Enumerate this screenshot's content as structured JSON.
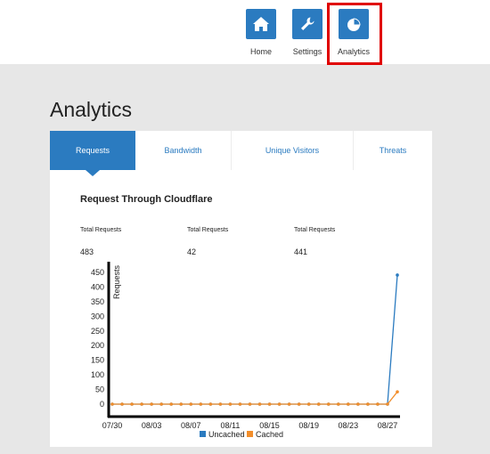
{
  "nav": {
    "items": [
      {
        "label": "Home",
        "icon": "home-icon"
      },
      {
        "label": "Settings",
        "icon": "wrench-icon"
      },
      {
        "label": "Analytics",
        "icon": "pie-chart-icon"
      }
    ],
    "highlighted": "Analytics",
    "icon_color": "#2b7bc0",
    "highlight_color": "#e00000"
  },
  "page": {
    "title": "Analytics"
  },
  "tabs": [
    {
      "label": "Requests",
      "active": true
    },
    {
      "label": "Bandwidth",
      "active": false
    },
    {
      "label": "Unique Visitors",
      "active": false
    },
    {
      "label": "Threats",
      "active": false
    }
  ],
  "section": {
    "title": "Request Through Cloudflare"
  },
  "stats": [
    {
      "label": "Total Requests",
      "value": "483"
    },
    {
      "label": "Total Requests",
      "value": "42"
    },
    {
      "label": "Total Requests",
      "value": "441"
    }
  ],
  "chart_data": {
    "type": "line",
    "ylabel": "Requests",
    "ylim": [
      0,
      450
    ],
    "yticks": [
      0,
      50,
      100,
      150,
      200,
      250,
      300,
      350,
      400,
      450
    ],
    "xtick_labels": [
      "07/30",
      "08/03",
      "08/07",
      "08/11",
      "08/15",
      "08/19",
      "08/23",
      "08/27"
    ],
    "x": [
      "07/30",
      "07/31",
      "08/01",
      "08/02",
      "08/03",
      "08/04",
      "08/05",
      "08/06",
      "08/07",
      "08/08",
      "08/09",
      "08/10",
      "08/11",
      "08/12",
      "08/13",
      "08/14",
      "08/15",
      "08/16",
      "08/17",
      "08/18",
      "08/19",
      "08/20",
      "08/21",
      "08/22",
      "08/23",
      "08/24",
      "08/25",
      "08/26",
      "08/27",
      "08/28"
    ],
    "series": [
      {
        "name": "Uncached",
        "color": "#2b7bc0",
        "values": [
          0,
          0,
          0,
          0,
          0,
          0,
          0,
          0,
          0,
          0,
          0,
          0,
          0,
          0,
          0,
          0,
          0,
          0,
          0,
          0,
          0,
          0,
          0,
          0,
          0,
          0,
          0,
          0,
          0,
          441
        ]
      },
      {
        "name": "Cached",
        "color": "#f28e2b",
        "values": [
          0,
          0,
          0,
          0,
          0,
          0,
          0,
          0,
          0,
          0,
          0,
          0,
          0,
          0,
          0,
          0,
          0,
          0,
          0,
          0,
          0,
          0,
          0,
          0,
          0,
          0,
          0,
          0,
          0,
          42
        ]
      }
    ],
    "legend_position": "bottom"
  }
}
